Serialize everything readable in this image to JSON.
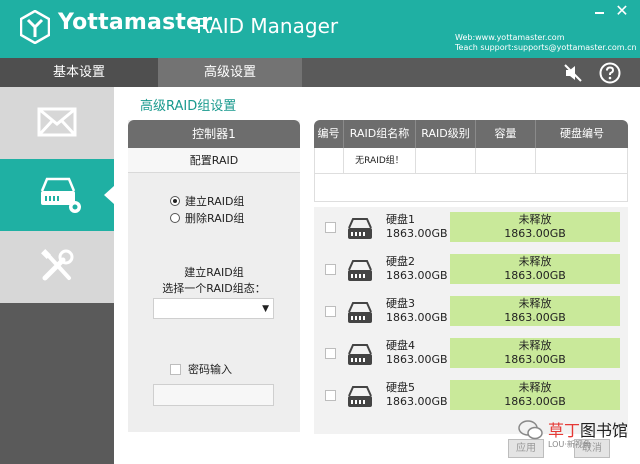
{
  "header": {
    "brand": "Yottamaster",
    "app_title": "RAID Manager",
    "web": "Web:www.yottamaster.com",
    "support": "Teach support:supports@yottamaster.com.cn",
    "accent_color": "#1fb0a3"
  },
  "nav": {
    "tabs": [
      {
        "label": "基本设置",
        "active": false
      },
      {
        "label": "高级设置",
        "active": true
      }
    ],
    "icons": [
      "mute-icon",
      "help-icon"
    ]
  },
  "sidebar": {
    "items": [
      {
        "icon": "mail-icon",
        "active": false
      },
      {
        "icon": "raid-drive-icon",
        "active": true
      },
      {
        "icon": "tools-icon",
        "active": false
      }
    ]
  },
  "main": {
    "section_title": "高级RAID组设置",
    "controller": {
      "title": "控制器1",
      "subtitle": "配置RAID",
      "options": [
        {
          "label": "建立RAID组",
          "selected": true
        },
        {
          "label": "删除RAID组",
          "selected": false
        }
      ],
      "create_label": "建立RAID组",
      "select_label": "选择一个RAID组态：",
      "select_value": "",
      "password_label": "密码输入",
      "password_checked": false,
      "password_value": ""
    },
    "table": {
      "headers": [
        "编号",
        "RAID组名称",
        "RAID级别",
        "容量",
        "硬盘编号"
      ],
      "rows": [
        [
          "",
          "无RAID组！",
          "",
          "",
          ""
        ]
      ]
    },
    "disks": [
      {
        "name": "硬盘1",
        "size": "1863.00GB",
        "status": "未释放",
        "status_size": "1863.00GB"
      },
      {
        "name": "硬盘2",
        "size": "1863.00GB",
        "status": "未释放",
        "status_size": "1863.00GB"
      },
      {
        "name": "硬盘3",
        "size": "1863.00GB",
        "status": "未释放",
        "status_size": "1863.00GB"
      },
      {
        "name": "硬盘4",
        "size": "1863.00GB",
        "status": "未释放",
        "status_size": "1863.00GB"
      },
      {
        "name": "硬盘5",
        "size": "1863.00GB",
        "status": "未释放",
        "status_size": "1863.00GB"
      }
    ],
    "buttons": {
      "apply": "应用",
      "cancel": "取消"
    }
  },
  "watermark": {
    "text_red": "草丁",
    "text_dark": "图书馆",
    "sub": "LOU·新视角"
  }
}
